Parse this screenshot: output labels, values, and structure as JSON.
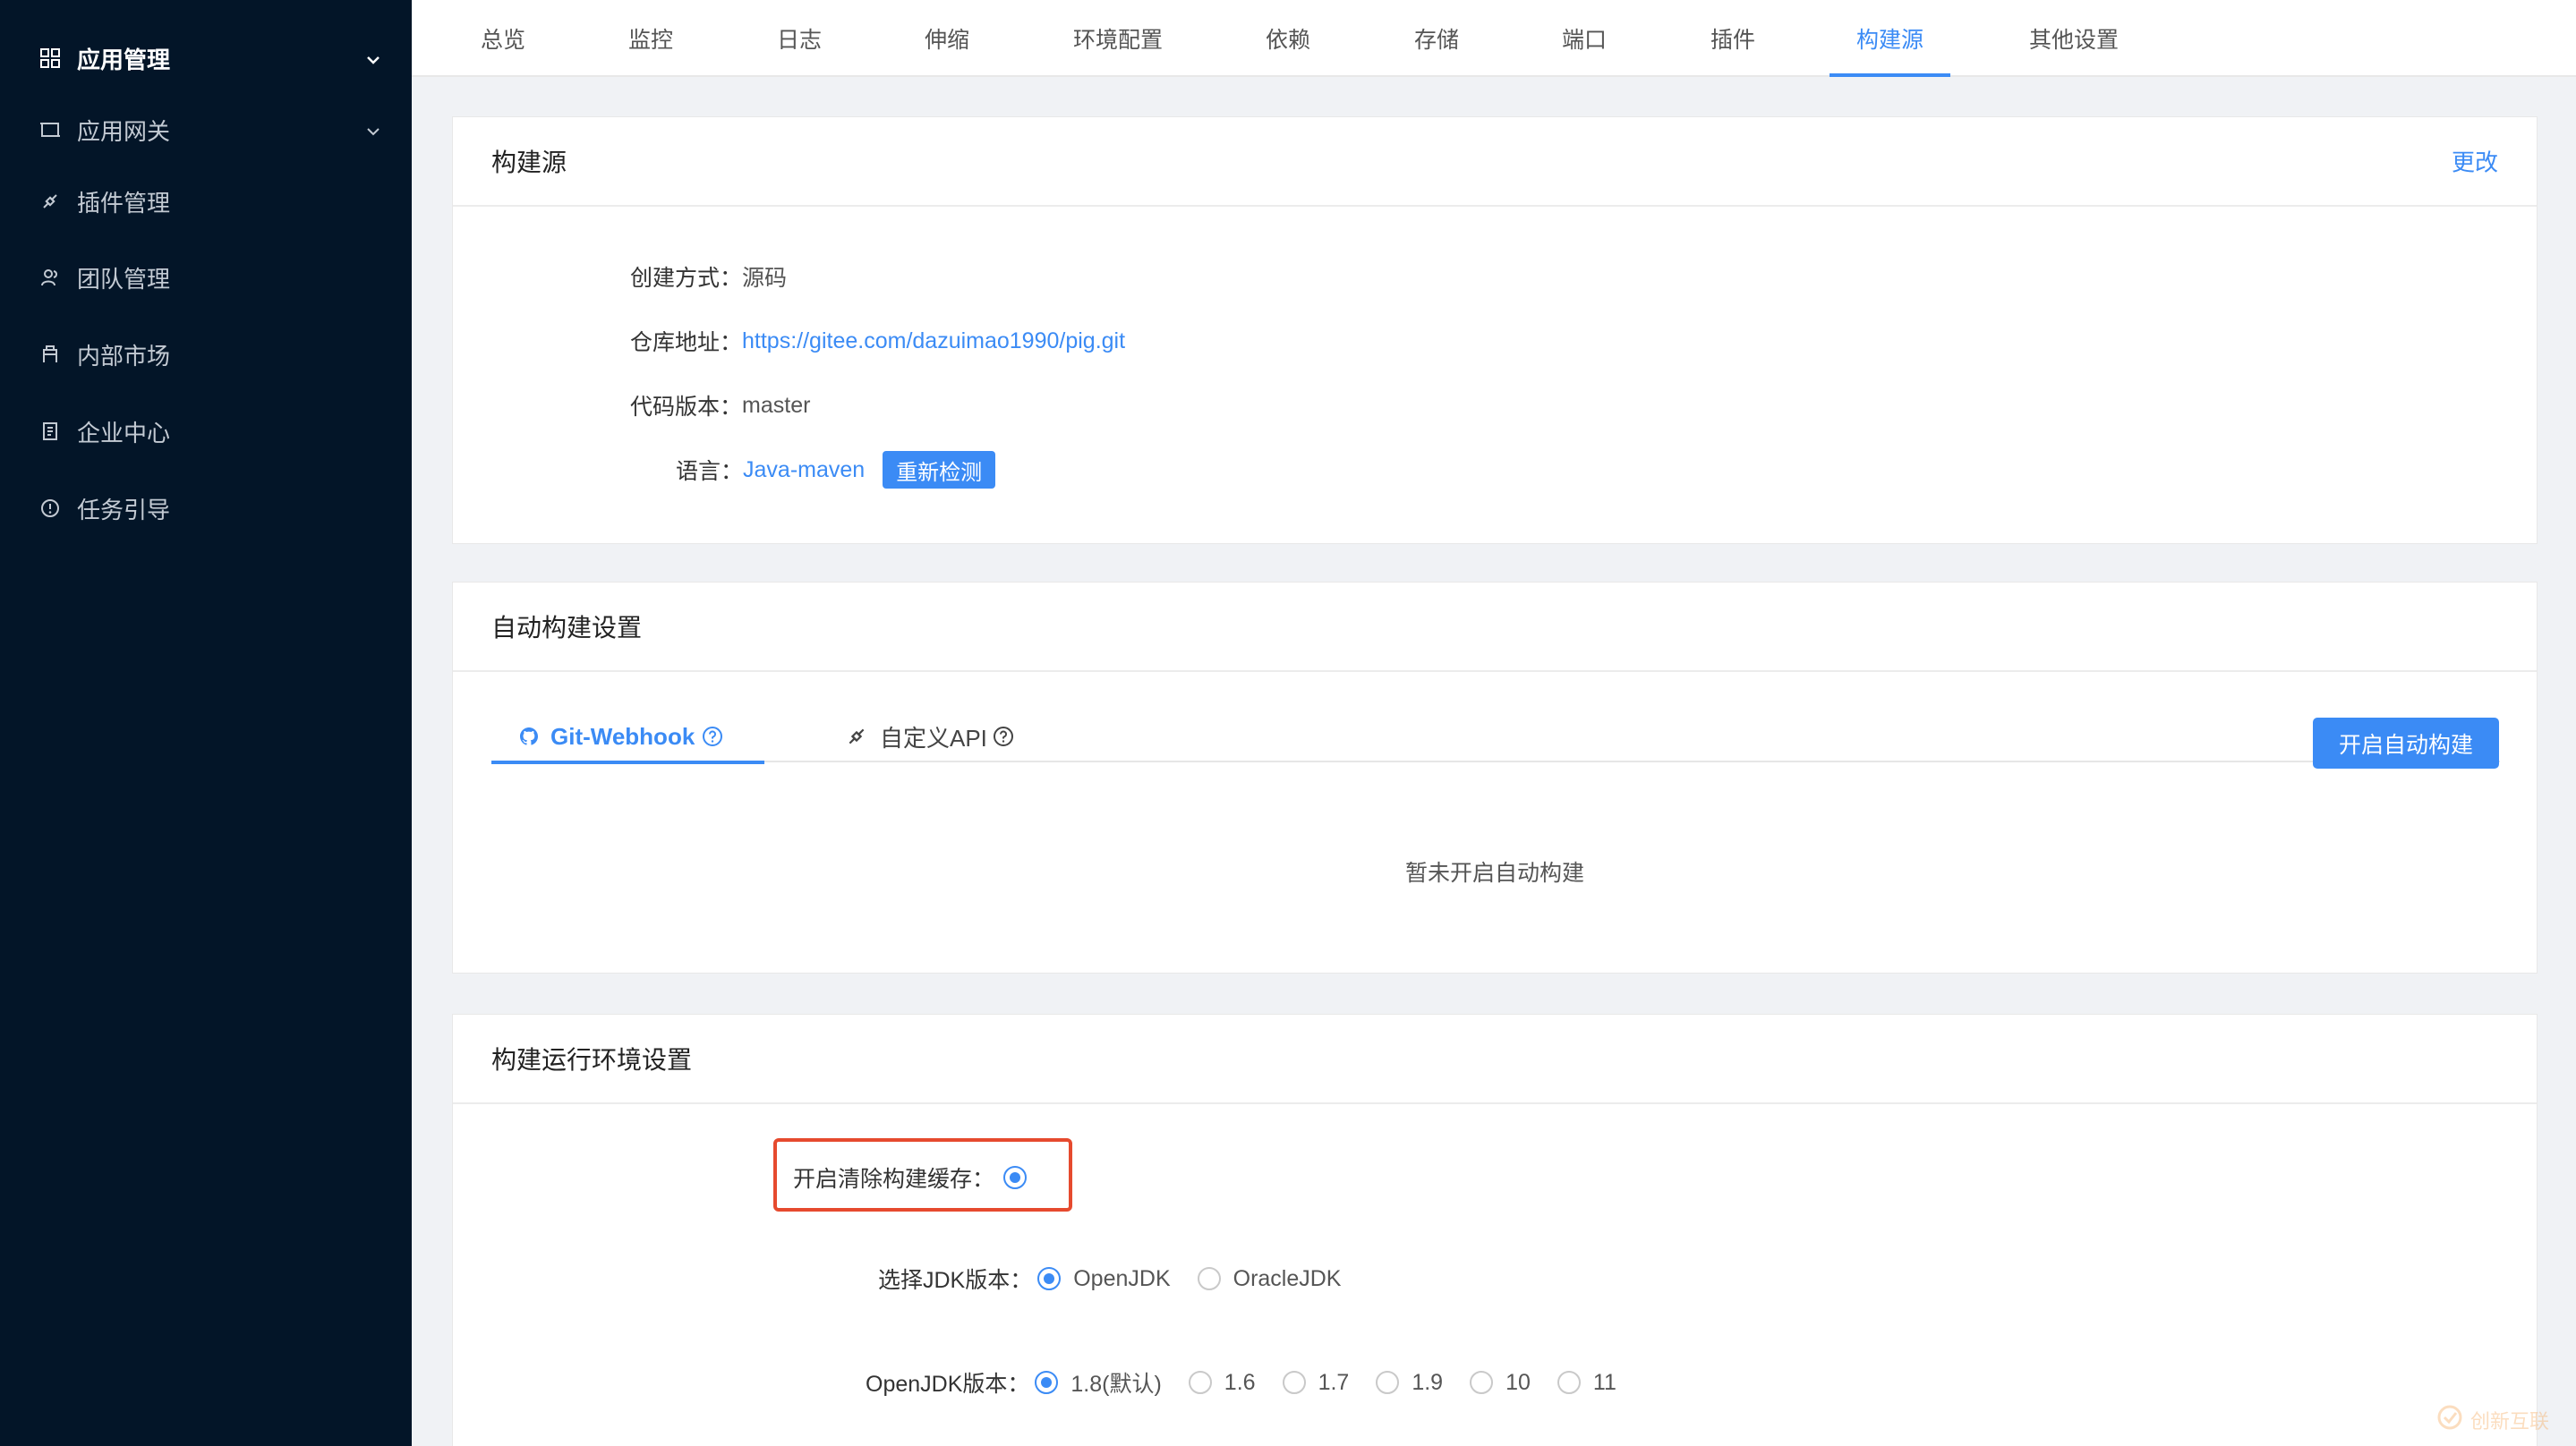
{
  "sidebar": {
    "items": [
      {
        "label": "应用管理",
        "icon": "grid-icon"
      },
      {
        "label": "应用网关",
        "icon": "gateway-icon"
      },
      {
        "label": "插件管理",
        "icon": "plugin-icon"
      },
      {
        "label": "团队管理",
        "icon": "team-icon"
      },
      {
        "label": "内部市场",
        "icon": "market-icon"
      },
      {
        "label": "企业中心",
        "icon": "enterprise-icon"
      },
      {
        "label": "任务引导",
        "icon": "info-circle-icon"
      }
    ]
  },
  "tabs": [
    "总览",
    "监控",
    "日志",
    "伸缩",
    "环境配置",
    "依赖",
    "存储",
    "端口",
    "插件",
    "构建源",
    "其他设置"
  ],
  "active_tab": "构建源",
  "build_source": {
    "title": "构建源",
    "change_link": "更改",
    "create_method_label": "创建方式：",
    "create_method_value": "源码",
    "repo_label": "仓库地址：",
    "repo_url": "https://gitee.com/dazuimao1990/pig.git",
    "code_version_label": "代码版本：",
    "code_version_value": "master",
    "language_label": "语言：",
    "language_value": "Java-maven",
    "recheck_button": "重新检测"
  },
  "auto_build": {
    "title": "自动构建设置",
    "tab_webhook": "Git-Webhook",
    "tab_custom_api": "自定义API",
    "enable_button": "开启自动构建",
    "empty_text": "暂未开启自动构建"
  },
  "runtime_env": {
    "title": "构建运行环境设置",
    "clear_cache_label": "开启清除构建缓存：",
    "jdk_label": "选择JDK版本：",
    "jdk_options": [
      "OpenJDK",
      "OracleJDK"
    ],
    "jdk_selected": "OpenJDK",
    "openjdk_version_label": "OpenJDK版本：",
    "openjdk_versions": [
      "1.8(默认)",
      "1.6",
      "1.7",
      "1.9",
      "10",
      "11"
    ],
    "openjdk_selected": "1.8(默认)"
  },
  "colors": {
    "sidebar_bg": "#031528",
    "accent": "#3b8bf5",
    "highlight_border": "#e64a2e",
    "page_bg": "#f0f2f5"
  },
  "watermark": "创新互联"
}
